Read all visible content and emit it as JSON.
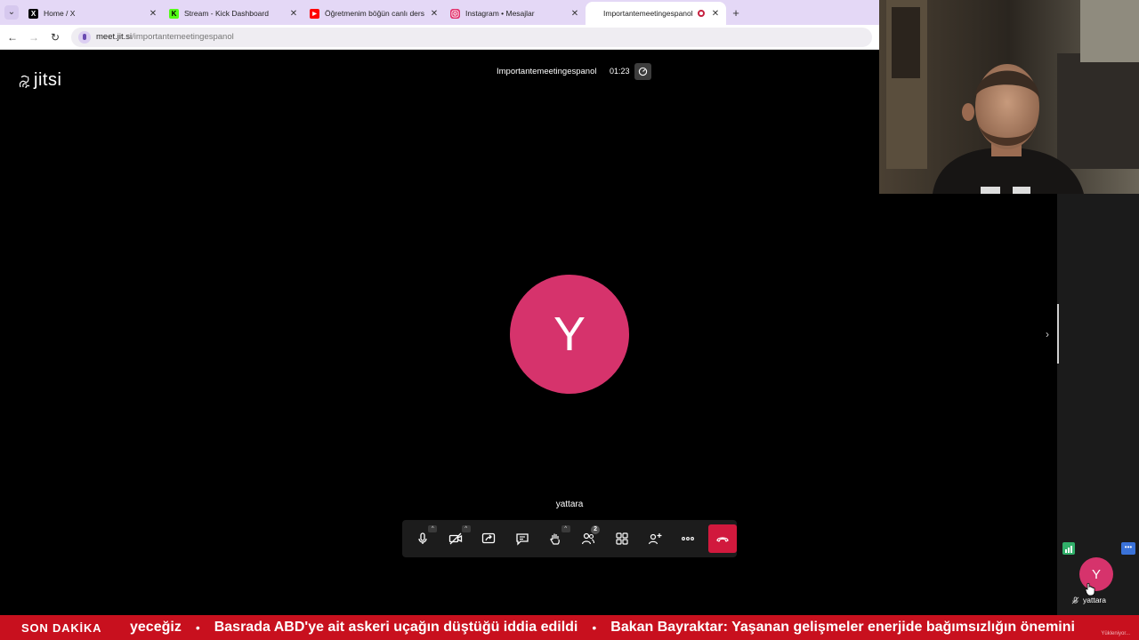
{
  "browser": {
    "tabs": [
      {
        "title": "Home / X",
        "icon": "x-logo-icon"
      },
      {
        "title": "Stream - Kick Dashboard",
        "icon": "kick-logo-icon"
      },
      {
        "title": "Öğretmenim böğün canlı ders",
        "icon": "youtube-logo-icon"
      },
      {
        "title": "Instagram • Mesajlar",
        "icon": "instagram-logo-icon"
      },
      {
        "title": "Importantemeetingespanol",
        "icon": "recording-icon",
        "active": true
      }
    ],
    "address": {
      "host": "meet.jit.si",
      "path": "/importantemeetingespanol"
    }
  },
  "meeting": {
    "logo_text": "jitsi",
    "title": "Importantemeetingespanol",
    "timer": "01:23",
    "dominant_avatar_letter": "Y",
    "dominant_name": "yattara",
    "participants_count": "2",
    "toolbar": [
      "microphone",
      "camera-off",
      "share-screen",
      "chat",
      "raise-hand",
      "participants",
      "tile-view",
      "invite",
      "more-actions",
      "leave"
    ]
  },
  "filmstrip": {
    "avatar_letter": "Y",
    "name": "yattara"
  },
  "ticker": {
    "label": "SON DAKİKA",
    "items": [
      "yeceğiz",
      "Basrada ABD'ye ait askeri uçağın düştüğü iddia edildi",
      "Bakan Bayraktar: Yaşanan gelişmeler enerjide bağımsızlığın önemini"
    ],
    "status": "Yükleniyor..."
  },
  "colors": {
    "tab_strip": "#e4d8f6",
    "avatar": "#d6336c",
    "hangup": "#d1193d",
    "ticker_bg": "#c8101e"
  }
}
